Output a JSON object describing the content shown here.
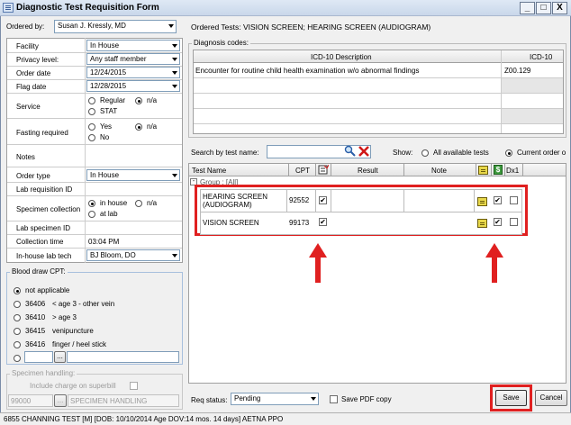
{
  "window": {
    "title": "Diagnostic Test Requisition Form",
    "min": "_",
    "max": "□",
    "close": "X"
  },
  "ordered_by": {
    "label": "Ordered by:",
    "value": "Susan J. Kressly, MD"
  },
  "ordered_tests": "Ordered Tests: VISION SCREEN; HEARING SCREEN (AUDIOGRAM)",
  "form": {
    "facility": {
      "label": "Facility",
      "value": "In House"
    },
    "privacy": {
      "label": "Privacy level:",
      "value": "Any staff member"
    },
    "order_date": {
      "label": "Order date",
      "value": "12/24/2015"
    },
    "flag_date": {
      "label": "Flag date",
      "value": "12/28/2015"
    },
    "service": {
      "label": "Service",
      "opt_regular": "Regular",
      "opt_na": "n/a",
      "opt_stat": "STAT"
    },
    "fasting": {
      "label": "Fasting required",
      "opt_yes": "Yes",
      "opt_na": "n/a",
      "opt_no": "No"
    },
    "notes": {
      "label": "Notes"
    },
    "order_type": {
      "label": "Order type",
      "value": "In House"
    },
    "lab_req_id": {
      "label": "Lab requisition ID"
    },
    "specimen_collection": {
      "label": "Specimen collection",
      "opt_in_house": "in house",
      "opt_na": "n/a",
      "opt_at_lab": "at lab"
    },
    "lab_specimen_id": {
      "label": "Lab specimen ID"
    },
    "collection_time": {
      "label": "Collection time",
      "value": "03:04 PM"
    },
    "in_house_lab_tech": {
      "label": "In-house lab tech",
      "value": "BJ Bloom, DO"
    }
  },
  "blood_draw": {
    "title": "Blood draw CPT:",
    "options": [
      {
        "code": "",
        "desc": "not applicable",
        "selected": true
      },
      {
        "code": "36406",
        "desc": "< age 3 - other vein",
        "selected": false
      },
      {
        "code": "36410",
        "desc": "> age 3",
        "selected": false
      },
      {
        "code": "36415",
        "desc": "venipuncture",
        "selected": false
      },
      {
        "code": "36416",
        "desc": "finger / heel stick",
        "selected": false
      }
    ],
    "custom_btn": "..."
  },
  "specimen_handling": {
    "title": "Specimen handling:",
    "include_label": "Include charge on superbill",
    "code": "99000",
    "btn": "...",
    "desc": "SPECIMEN HANDLING"
  },
  "diagnosis": {
    "title": "Diagnosis codes:",
    "col_desc": "ICD-10 Description",
    "col_code": "ICD-10",
    "rows": [
      {
        "desc": "Encounter for routine child health examination w/o abnormal findings",
        "code": "Z00.129"
      }
    ]
  },
  "search": {
    "label": "Search by test name:",
    "show_label": "Show:",
    "opt_all": "All available tests",
    "opt_current": "Current order o"
  },
  "tests_table": {
    "col_name": "Test Name",
    "col_cpt": "CPT",
    "col_result": "Result",
    "col_note": "Note",
    "col_dx": "Dx1",
    "group_label": "Group : [All]",
    "rows": [
      {
        "name": "HEARING SCREEN (AUDIOGRAM)",
        "cpt": "92552"
      },
      {
        "name": "VISION SCREEN",
        "cpt": "99173"
      }
    ]
  },
  "footer": {
    "req_status_label": "Req status:",
    "req_status_value": "Pending",
    "save_pdf": "Save PDF copy",
    "save": "Save",
    "cancel": "Cancel"
  },
  "status_bar": "6855 CHANNING TEST [M] [DOB: 10/10/2014 Age DOV:14 mos. 14 days] AETNA PPO",
  "colors": {
    "annotation_red": "#e02020",
    "title_bar": "#c9d7ea"
  }
}
